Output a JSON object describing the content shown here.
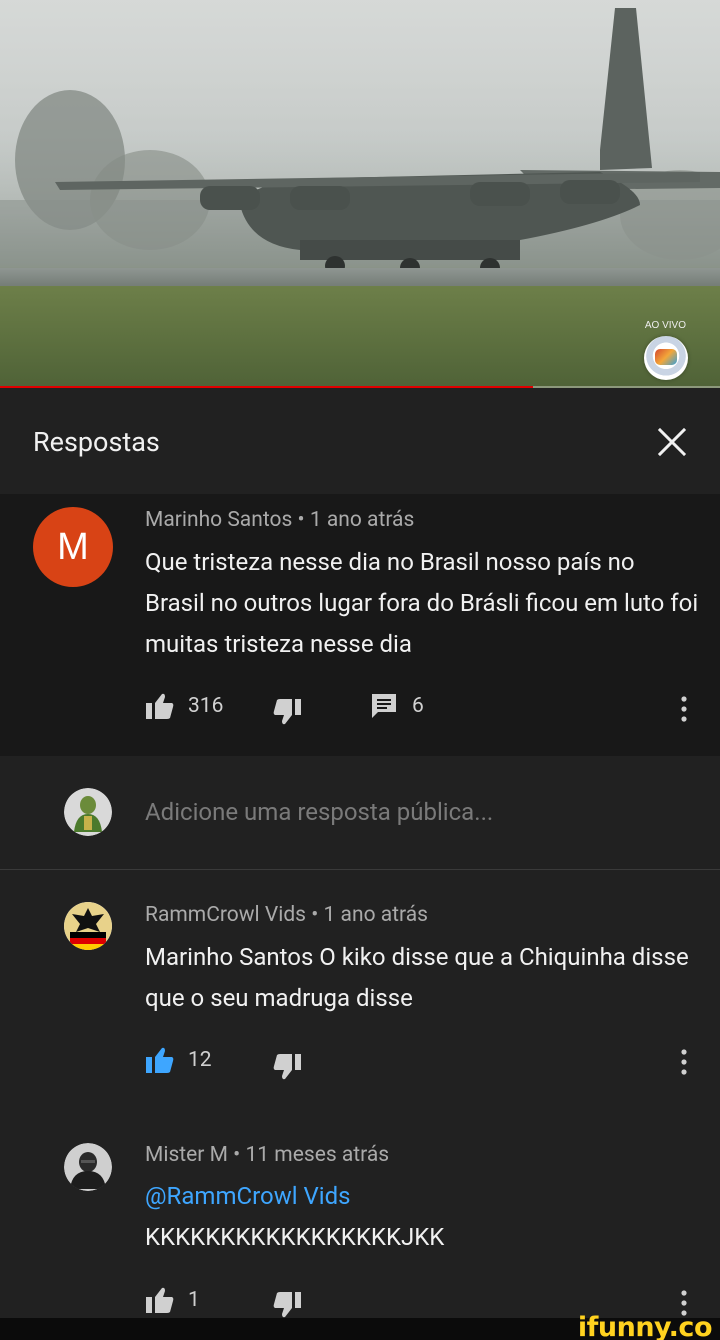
{
  "video": {
    "live_label": "AO VIVO",
    "progress": 0.74,
    "colors": {
      "progress": "#e00000"
    }
  },
  "header": {
    "title": "Respostas",
    "close_icon": "close-icon"
  },
  "parent_comment": {
    "avatar_letter": "M",
    "avatar_color": "#d84315",
    "author": "Marinho Santos",
    "time": "1 ano atrás",
    "text": "Que tristeza nesse dia  no Brasil nosso país no Brasil no outros lugar fora do Brásli ficou em luto foi muitas tristeza nesse dia",
    "likes": "316",
    "replies": "6"
  },
  "reply_input": {
    "placeholder": "Adicione uma resposta pública..."
  },
  "replies": [
    {
      "author": "RammCrowl Vids",
      "time": "1 ano atrás",
      "text": "Marinho Santos O kiko disse que a Chiquinha disse que o seu madruga disse",
      "likes": "12",
      "liked": true
    },
    {
      "author": "Mister M",
      "time": "11 meses atrás",
      "mention": "@RammCrowl Vids",
      "text": "KKKKKKKKKKKKKKKKKJKK",
      "likes": "1",
      "liked": false
    }
  ],
  "separator": "•",
  "watermark": "ifunny.co",
  "colors": {
    "background": "#212121",
    "parent_bg": "#181818",
    "link": "#3ea6ff"
  }
}
